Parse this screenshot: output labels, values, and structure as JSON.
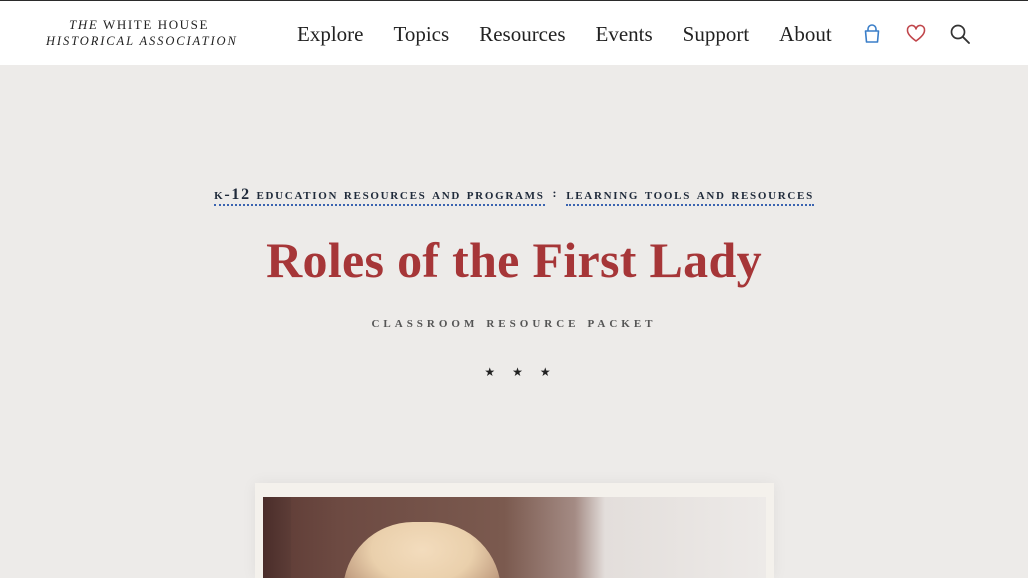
{
  "header": {
    "logo": {
      "line1_italic": "THE",
      "line1_rest": "WHITE HOUSE",
      "line2": "HISTORICAL ASSOCIATION"
    },
    "nav": [
      "Explore",
      "Topics",
      "Resources",
      "Events",
      "Support",
      "About"
    ],
    "icons": {
      "cart": "shopping-bag-icon",
      "favorites": "heart-icon",
      "search": "search-icon"
    },
    "colors": {
      "cart": "#3a7ec8",
      "favorites": "#c0454a"
    }
  },
  "breadcrumb": {
    "items": [
      "K-12 Education Resources and Programs",
      "Learning Tools and Resources"
    ],
    "separator": ":"
  },
  "page": {
    "title": "Roles of the First Lady",
    "subtitle": "Classroom Resource Packet",
    "ornament": "★ ★ ★"
  },
  "colors": {
    "title": "#a63638",
    "link_underline": "#3a63b0",
    "background": "#edebe9"
  }
}
